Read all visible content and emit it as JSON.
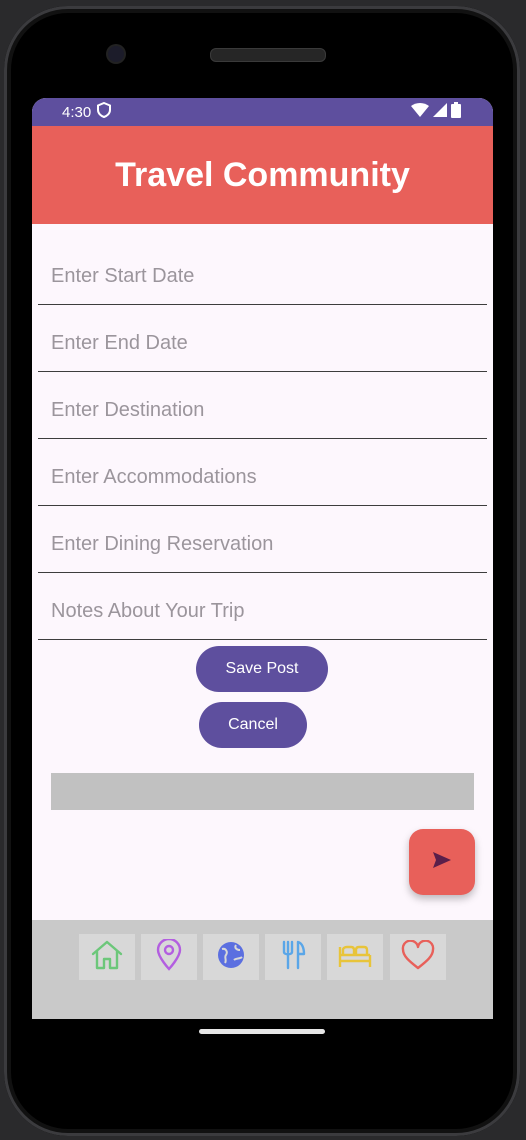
{
  "status": {
    "time": "4:30"
  },
  "app": {
    "title": "Travel Community"
  },
  "form": {
    "start_date_placeholder": "Enter Start Date",
    "end_date_placeholder": "Enter End Date",
    "destination_placeholder": "Enter Destination",
    "accommodations_placeholder": "Enter Accommodations",
    "dining_placeholder": "Enter Dining Reservation",
    "notes_placeholder": "Notes About Your Trip"
  },
  "buttons": {
    "save_label": "Save Post",
    "cancel_label": "Cancel"
  },
  "colors": {
    "primary": "#5e4f9e",
    "accent": "#e8605a",
    "background": "#fdf7fd",
    "nav_home": "#6cc77a",
    "nav_location": "#b35ee0",
    "nav_globe": "#5b6fe0",
    "nav_dining": "#5aa6e8",
    "nav_bed": "#e8c43a",
    "nav_heart": "#e8605a"
  },
  "nav": {
    "items": [
      "home-icon",
      "location-pin-icon",
      "globe-icon",
      "dining-icon",
      "bed-icon",
      "heart-icon"
    ]
  }
}
